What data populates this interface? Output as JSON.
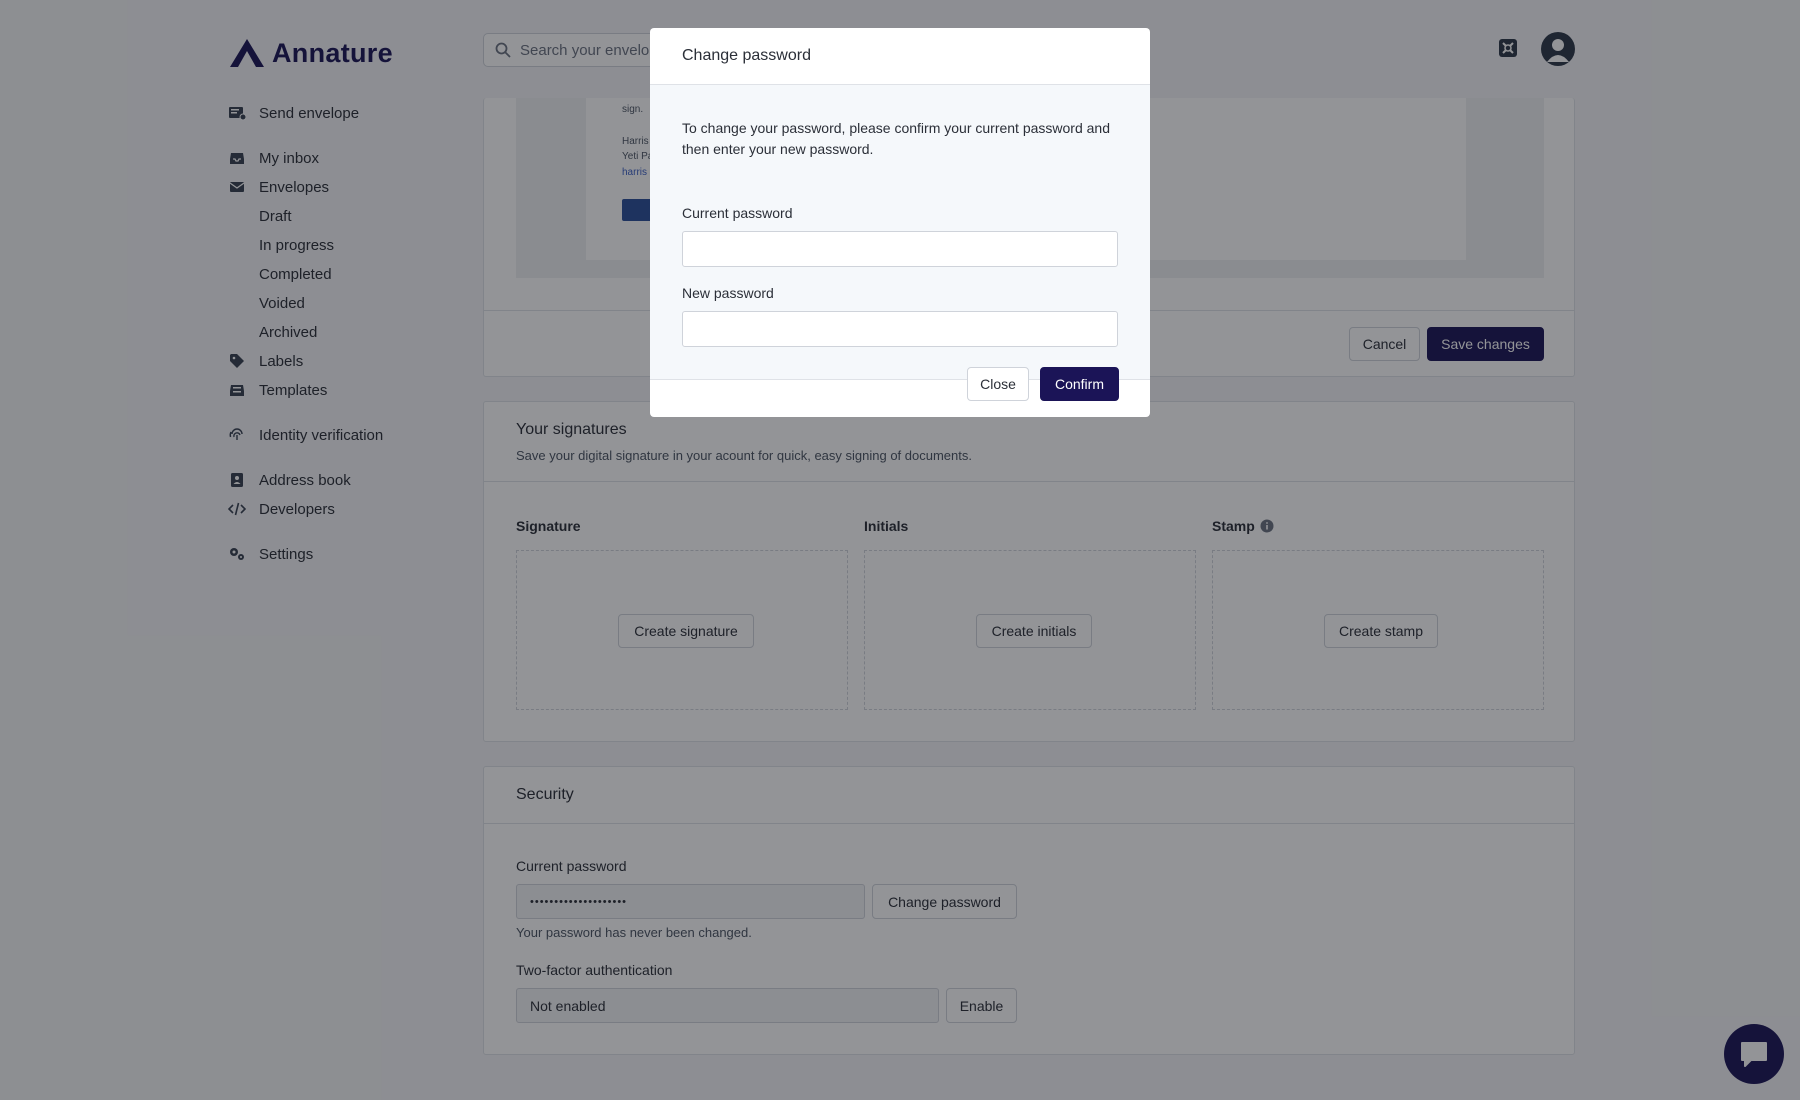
{
  "brand": {
    "name": "Annature",
    "color": "#1b1457"
  },
  "search": {
    "placeholder": "Search your envelopes"
  },
  "sidebar": {
    "send_envelope": "Send envelope",
    "my_inbox": "My inbox",
    "envelopes": "Envelopes",
    "draft": "Draft",
    "in_progress": "In progress",
    "completed": "Completed",
    "voided": "Voided",
    "archived": "Archived",
    "labels": "Labels",
    "templates": "Templates",
    "identity_verification": "Identity verification",
    "address_book": "Address book",
    "developers": "Developers",
    "settings": "Settings"
  },
  "preview": {
    "line1": "sign.",
    "line2": "Harris",
    "line3": "Yeti Pa",
    "line4": "harris"
  },
  "branding_card": {
    "cancel": "Cancel",
    "save": "Save changes"
  },
  "signatures": {
    "title": "Your signatures",
    "subtitle": "Save your digital signature in your acount for quick, easy signing of documents.",
    "signature_label": "Signature",
    "initials_label": "Initials",
    "stamp_label": "Stamp",
    "create_signature": "Create signature",
    "create_initials": "Create initials",
    "create_stamp": "Create stamp"
  },
  "security": {
    "title": "Security",
    "current_password_label": "Current password",
    "current_password_value": "••••••••••••••••••••",
    "change_password": "Change password",
    "password_help": "Your password has never been changed.",
    "two_factor_label": "Two-factor authentication",
    "two_factor_value": "Not enabled",
    "enable": "Enable"
  },
  "modal": {
    "title": "Change password",
    "description": "To change your password, please confirm your current password and then enter your new password.",
    "current_password_label": "Current password",
    "current_password_value": "",
    "new_password_label": "New password",
    "new_password_value": "",
    "close": "Close",
    "confirm": "Confirm"
  }
}
